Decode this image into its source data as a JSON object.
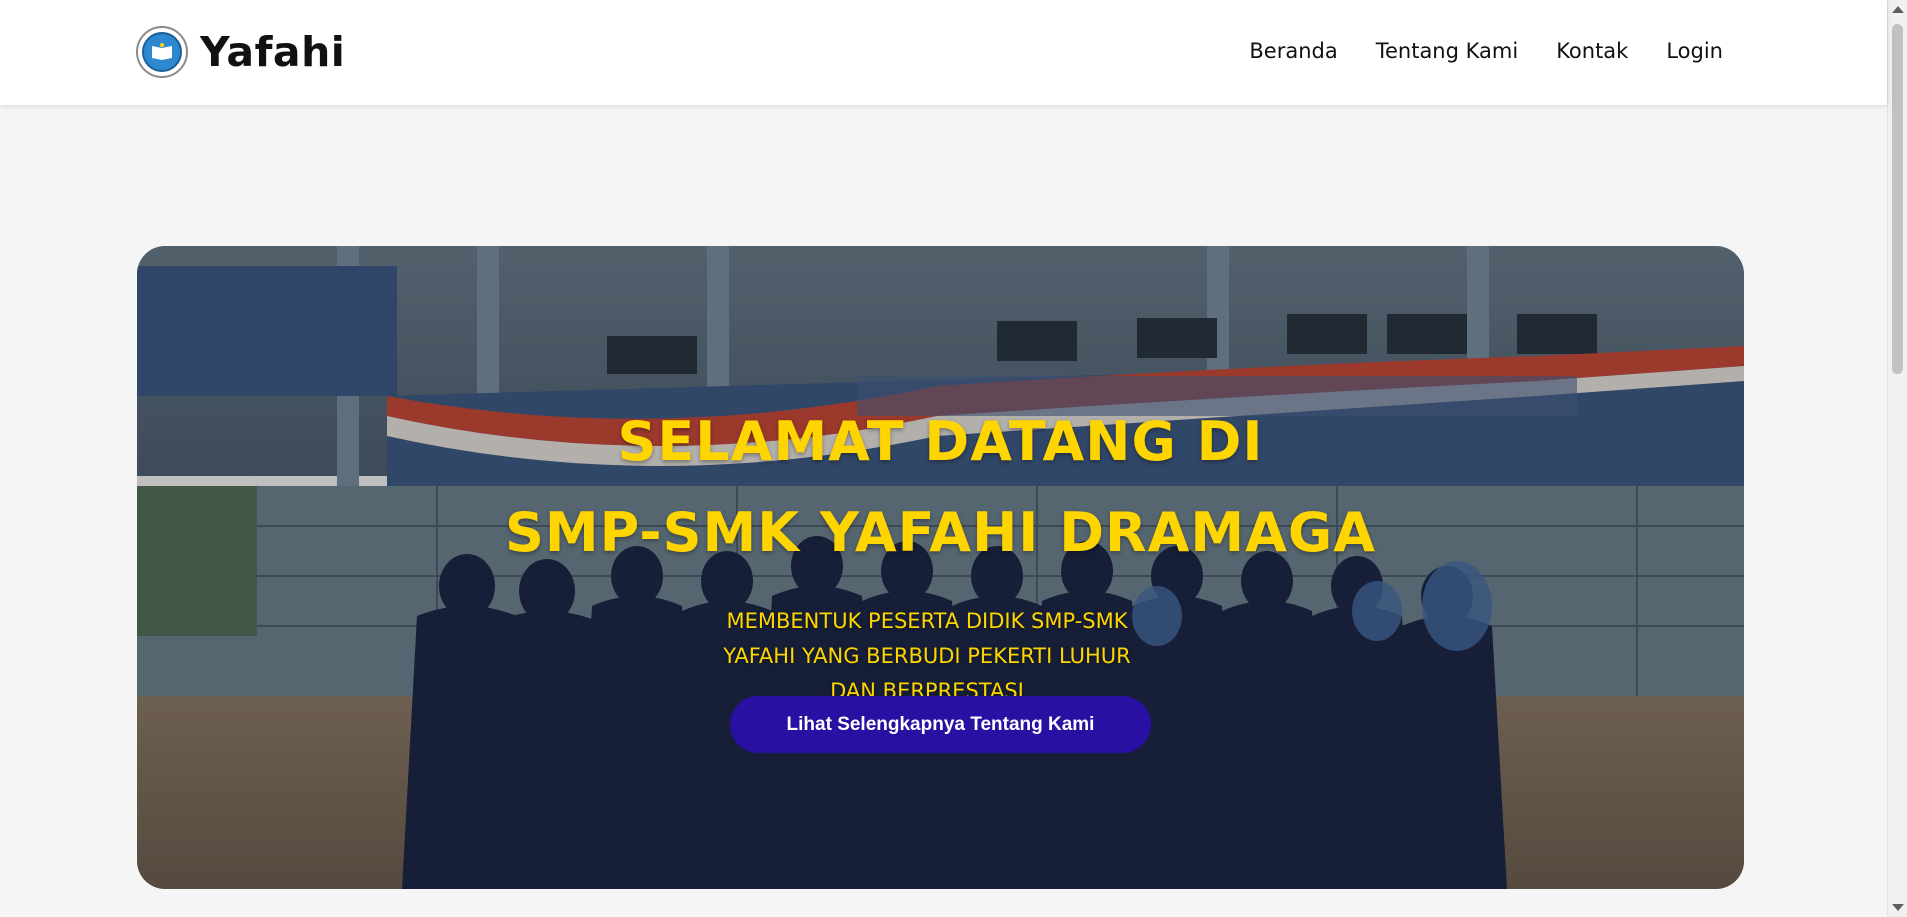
{
  "header": {
    "brand_name": "Yafahi",
    "logo_icon": "school-emblem-icon",
    "nav": [
      {
        "label": "Beranda"
      },
      {
        "label": "Tentang Kami"
      },
      {
        "label": "Kontak"
      },
      {
        "label": "Login"
      }
    ]
  },
  "hero": {
    "title_line1": "SELAMAT DATANG DI",
    "title_line2": "SMP-SMK YAFAHI DRAMAGA",
    "subtitle": "MEMBENTUK PESERTA DIDIK SMP-SMK YAFAHI YANG BERBUDI PEKERTI LUHUR DAN BERPRESTASI",
    "button_label": "Lihat Selengkapnya Tentang Kami",
    "background_image": "school-group-photo",
    "banner_text": "SMP-SMK YAFAHI DRAMAGA"
  },
  "colors": {
    "accent_yellow": "#ffd500",
    "button_purple": "#2a0fa3",
    "page_bg": "#f5f5f5"
  }
}
